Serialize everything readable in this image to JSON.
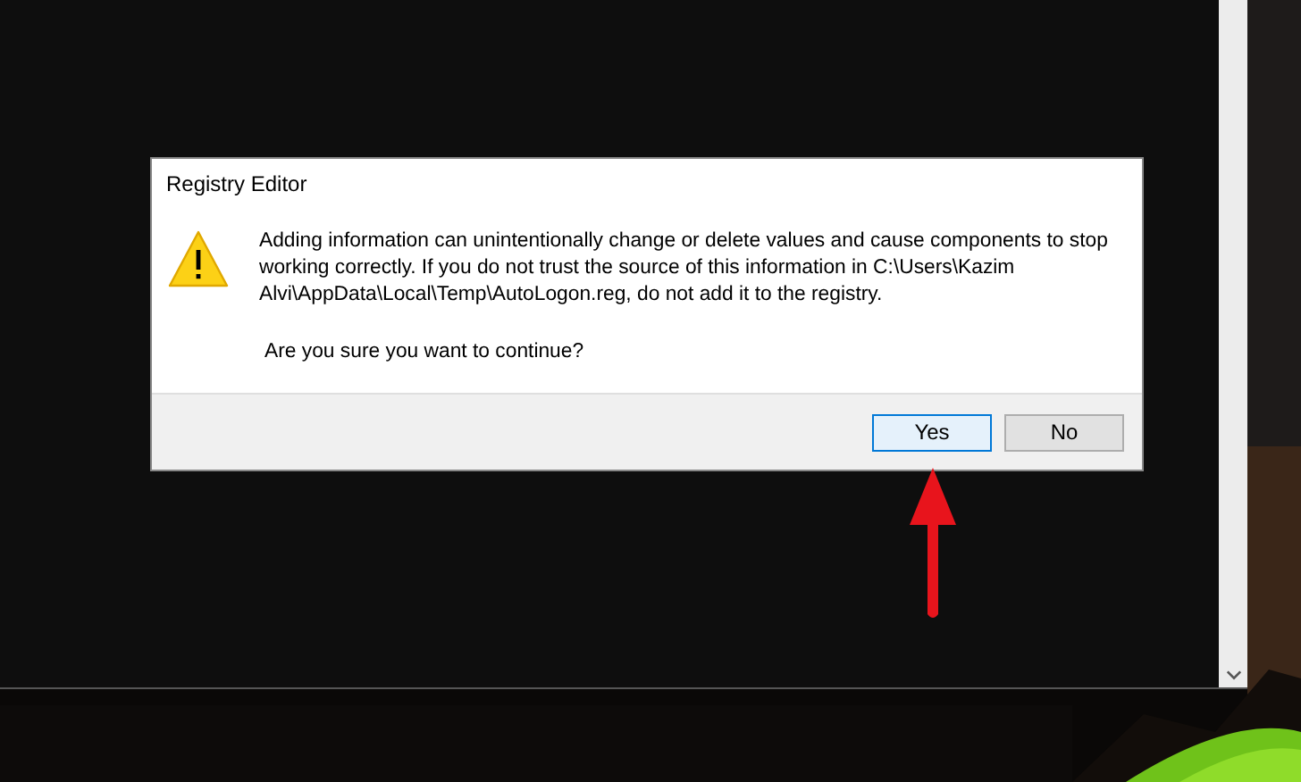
{
  "dialog": {
    "title": "Registry Editor",
    "message": "Adding information can unintentionally change or delete values and cause components to stop working correctly. If you do not trust the source of this information in C:\\Users\\Kazim Alvi\\AppData\\Local\\Temp\\AutoLogon.reg, do not add it to the registry.",
    "question": "Are you sure you want to continue?",
    "buttons": [
      {
        "label": "Yes",
        "selected": true
      },
      {
        "label": "No",
        "selected": false
      }
    ]
  }
}
